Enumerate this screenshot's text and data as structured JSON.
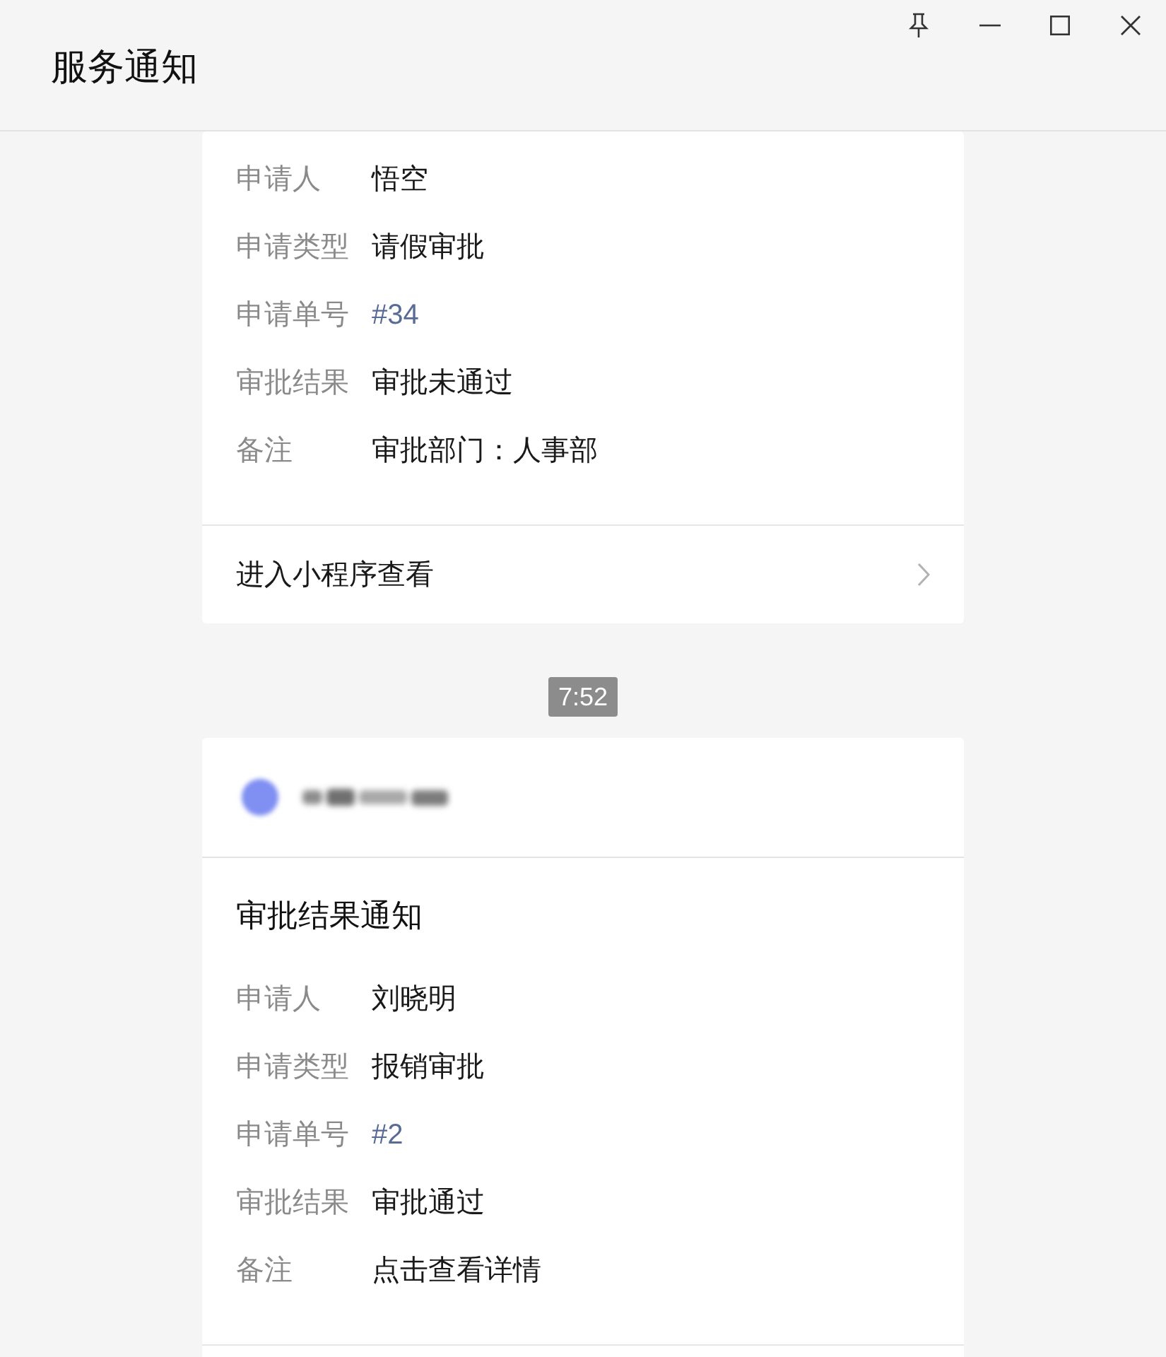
{
  "window": {
    "title": "服务通知"
  },
  "feed": [
    {
      "kind": "card",
      "fields": [
        {
          "label": "申请人",
          "value": "悟空",
          "kind": "text"
        },
        {
          "label": "申请类型",
          "value": "请假审批",
          "kind": "text"
        },
        {
          "label": "申请单号",
          "value": "#34",
          "kind": "link"
        },
        {
          "label": "审批结果",
          "value": "审批未通过",
          "kind": "text"
        },
        {
          "label": "备注",
          "value": "审批部门：人事部",
          "kind": "text"
        }
      ],
      "footer_link": "进入小程序查看"
    },
    {
      "kind": "time",
      "text": "7:52"
    },
    {
      "kind": "card",
      "sender_blurred": true,
      "title": "审批结果通知",
      "fields": [
        {
          "label": "申请人",
          "value": "刘晓明",
          "kind": "text"
        },
        {
          "label": "申请类型",
          "value": "报销审批",
          "kind": "text"
        },
        {
          "label": "申请单号",
          "value": "#2",
          "kind": "link"
        },
        {
          "label": "审批结果",
          "value": "审批通过",
          "kind": "text"
        },
        {
          "label": "备注",
          "value": "点击查看详情",
          "kind": "text"
        }
      ]
    }
  ]
}
